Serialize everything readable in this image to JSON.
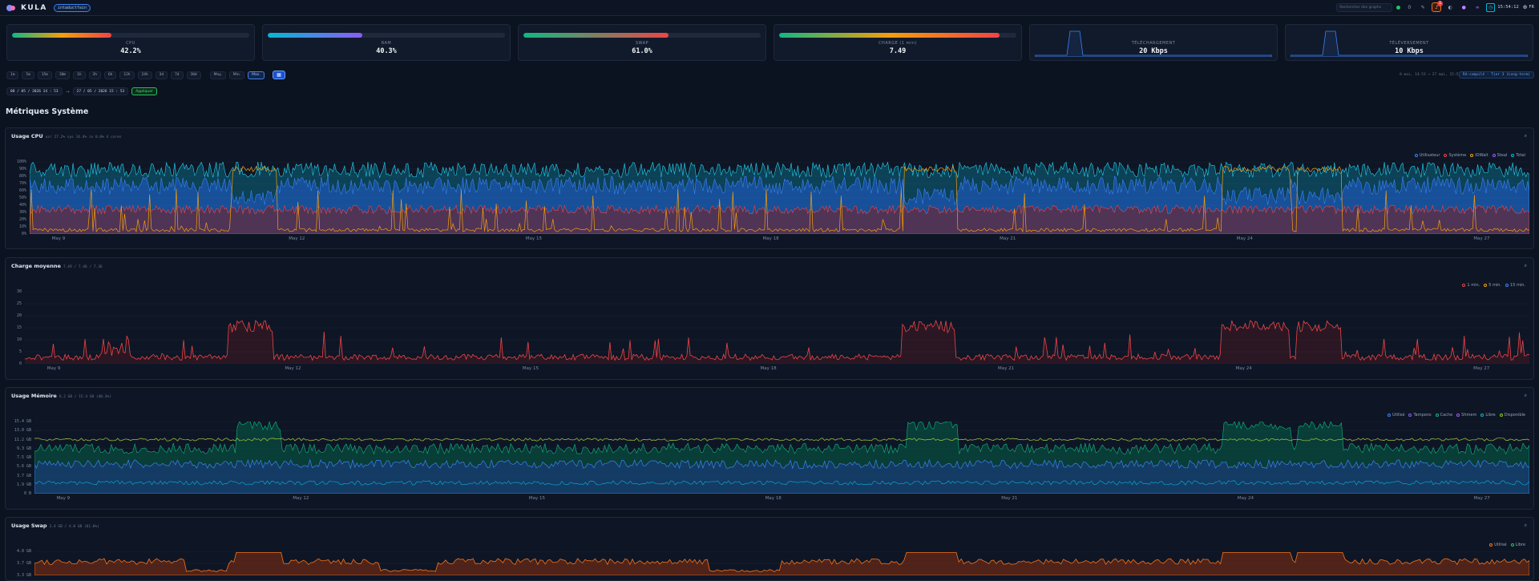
{
  "header": {
    "brand": "KULA",
    "host": "intaductfain",
    "search_placeholder": "Rechercher des graphs",
    "status_count": "0",
    "alert_count": "1",
    "clock": "15:54:12",
    "language": "FR"
  },
  "stats": [
    {
      "label": "CPU",
      "value": "42.2%",
      "fill": 0.42,
      "gradient": [
        "#10b981",
        "#f59e0b",
        "#ef4444"
      ]
    },
    {
      "label": "RAM",
      "value": "40.3%",
      "fill": 0.4,
      "gradient": [
        "#06b6d4",
        "#8b5cf6"
      ]
    },
    {
      "label": "SWAP",
      "value": "61.0%",
      "fill": 0.61,
      "gradient": [
        "#10b981",
        "#ef4444"
      ]
    },
    {
      "label": "CHARGE (1 min)",
      "value": "7.49",
      "fill": 0.93,
      "gradient": [
        "#10b981",
        "#f59e0b",
        "#ef4444"
      ]
    },
    {
      "label": "TÉLÉCHARGEMENT",
      "value": "20 Kbps",
      "spark": true
    },
    {
      "label": "TÉLÉVERSEMENT",
      "value": "10 Kbps",
      "spark": true
    }
  ],
  "toolbar": {
    "ranges": [
      "1m",
      "5m",
      "15m",
      "30m",
      "1h",
      "3h",
      "6h",
      "12h",
      "24h",
      "3d",
      "7d",
      "30d"
    ],
    "aggregations": [
      "Moy.",
      "Min.",
      "Max."
    ],
    "active_aggregation": "Max.",
    "calendar_icon": "calendar-icon"
  },
  "range": {
    "start": "08 / 05 / 2026   14 : 53",
    "end": "27 / 05 / 2026   15 : 53",
    "apply_label": "Appliquer",
    "info": "8 mai, 14:53 → 27 mai, 15:53",
    "tag": "Ré-compilé · Tier 3 (Long-term)"
  },
  "section_title": "Métriques Système",
  "panels": {
    "cpu": {
      "title": "Usage CPU",
      "subtitle": "usr 27.2% sys 14.4% io 0.0% 4 cores",
      "legend": [
        {
          "name": "Utilisateur",
          "color": "#3b82f6"
        },
        {
          "name": "Système",
          "color": "#ef4444"
        },
        {
          "name": "IOWait",
          "color": "#f59e0b"
        },
        {
          "name": "Steal",
          "color": "#a855f7"
        },
        {
          "name": "Total",
          "color": "#06b6d4"
        }
      ],
      "yticks": [
        "100%",
        "90%",
        "80%",
        "70%",
        "60%",
        "50%",
        "40%",
        "30%",
        "20%",
        "10%",
        "0%"
      ]
    },
    "load": {
      "title": "Charge moyenne",
      "subtitle": "7.49 / 7.46 / 7.36",
      "legend": [
        {
          "name": "1 min.",
          "color": "#ef4444"
        },
        {
          "name": "5 min.",
          "color": "#f59e0b"
        },
        {
          "name": "15 min.",
          "color": "#3b82f6"
        }
      ],
      "yticks": [
        "30",
        "25",
        "20",
        "15",
        "10",
        "5",
        "0"
      ]
    },
    "mem": {
      "title": "Usage Mémoire",
      "subtitle": "6.2 GB / 15.4 GB (40.3%)",
      "legend": [
        {
          "name": "Utilisé",
          "color": "#3b82f6"
        },
        {
          "name": "Tampons",
          "color": "#8b5cf6"
        },
        {
          "name": "Cache",
          "color": "#10b981"
        },
        {
          "name": "Shmem",
          "color": "#a855f7"
        },
        {
          "name": "Libre",
          "color": "#06b6d4"
        },
        {
          "name": "Disponible",
          "color": "#84cc16"
        }
      ],
      "yticks": [
        "15.4 GB",
        "13.0 GB",
        "11.2 GB",
        "9.3 GB",
        "7.5 GB",
        "5.6 GB",
        "3.7 GB",
        "1.9 GB",
        "0 B"
      ]
    },
    "swap": {
      "title": "Usage Swap",
      "subtitle": "2.4 GB / 4.0 GB (61.0%)",
      "legend": [
        {
          "name": "Utilisé",
          "color": "#f97316"
        },
        {
          "name": "Libre",
          "color": "#22c55e"
        }
      ],
      "yticks": [
        "4.0 GB",
        "3.7 GB",
        "3.3 GB"
      ]
    }
  },
  "xticks": [
    "May 9",
    "May 12",
    "May 15",
    "May 18",
    "May 21",
    "May 24",
    "May 27"
  ]
}
